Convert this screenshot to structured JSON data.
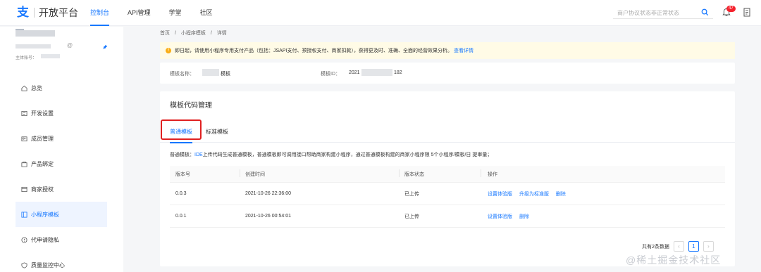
{
  "header": {
    "logo_glyph": "支",
    "logo_text": "开放平台",
    "nav": [
      {
        "label": "控制台",
        "active": true
      },
      {
        "label": "API管理",
        "active": false
      },
      {
        "label": "学堂",
        "active": false
      },
      {
        "label": "社区",
        "active": false
      }
    ],
    "search_placeholder": "商户协议状态非正常状态",
    "notification_count": "47"
  },
  "sidebar": {
    "at_symbol": "@",
    "account_label": "主体账号：",
    "menu": [
      {
        "label": "总览",
        "icon": "home-icon",
        "active": false
      },
      {
        "label": "开发设置",
        "icon": "settings-doc-icon",
        "active": false
      },
      {
        "label": "成员管理",
        "icon": "members-icon",
        "active": false
      },
      {
        "label": "产品绑定",
        "icon": "product-icon",
        "active": false
      },
      {
        "label": "商家授权",
        "icon": "merchant-icon",
        "active": false
      },
      {
        "label": "小程序模板",
        "icon": "template-icon",
        "active": true
      },
      {
        "label": "代申请隐私",
        "icon": "privacy-icon",
        "active": false
      },
      {
        "label": "质量监控中心",
        "icon": "quality-icon",
        "active": false
      }
    ]
  },
  "breadcrumb": [
    "首页",
    "/",
    "小程序模板",
    "/",
    "详情"
  ],
  "notice": {
    "text": "即日起，请使用小程序专用支付产品（包括：JSAPI支付、预授权支付、商家扣款），获得更及时、准确、全面的经营效果分析。",
    "link": "查看详情"
  },
  "template_info": {
    "name_label": "模板名称：",
    "name_suffix": "模板",
    "id_label": "模板ID：",
    "id_prefix": "2021",
    "id_suffix": "182"
  },
  "code_management": {
    "title": "模板代码管理",
    "tabs": [
      {
        "label": "普通模板",
        "active": true
      },
      {
        "label": "标准模板",
        "active": false
      }
    ],
    "description_prefix": "普通模板：",
    "description_link": "IDE",
    "description_rest": "上传代码生成普通模板，普通模板即可调用接口帮助商家构建小程序，通过普通模板构建的商家小程序限 5个小程序/模板/日 提审量；",
    "columns": [
      "版本号",
      "创建时间",
      "版本状态",
      "操作"
    ],
    "rows": [
      {
        "version": "0.0.3",
        "created": "2021-10-26 22:36:00",
        "status": "已上传",
        "actions": [
          "设置体验版",
          "升级为标准版",
          "删除"
        ]
      },
      {
        "version": "0.0.1",
        "created": "2021-10-26 00:54:01",
        "status": "已上传",
        "actions": [
          "设置体验版",
          "删除"
        ]
      }
    ],
    "pagination": {
      "total_text": "共有2条数据",
      "prev": "‹",
      "current": "1",
      "next": "›"
    }
  },
  "watermark": "@稀土掘金技术社区",
  "colors": {
    "accent": "#1677ff",
    "highlight": "#e02020",
    "notice_bg": "#fffbe6"
  }
}
